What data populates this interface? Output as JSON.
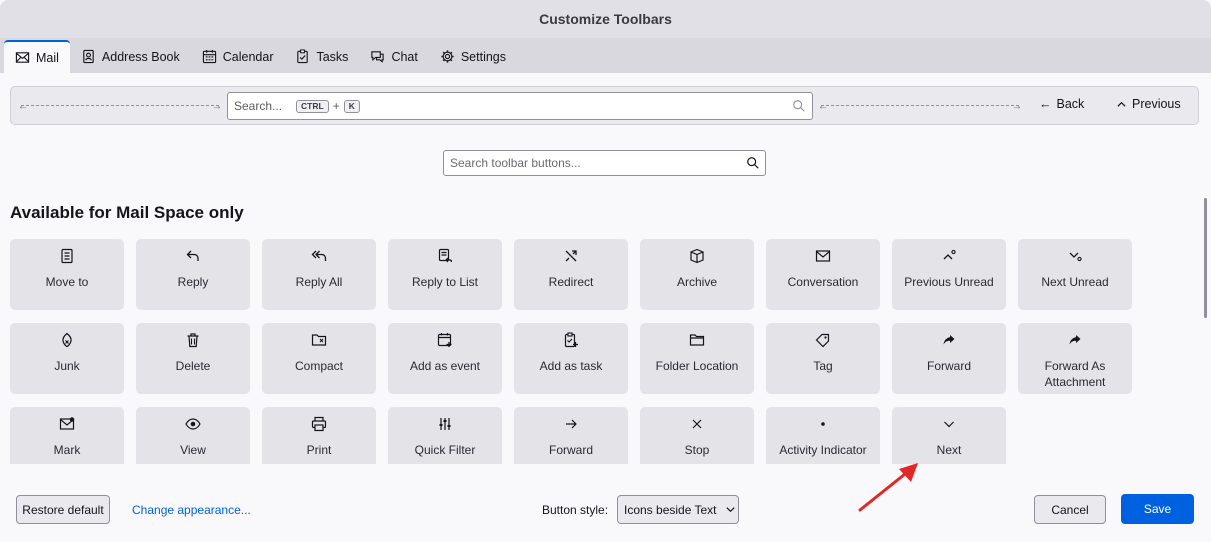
{
  "window": {
    "title": "Customize Toolbars"
  },
  "tabs": [
    {
      "label": "Mail",
      "icon": "mail-icon",
      "active": true
    },
    {
      "label": "Address Book",
      "icon": "address-book-icon"
    },
    {
      "label": "Calendar",
      "icon": "calendar-icon"
    },
    {
      "label": "Tasks",
      "icon": "tasks-icon"
    },
    {
      "label": "Chat",
      "icon": "chat-icon"
    },
    {
      "label": "Settings",
      "icon": "gear-icon"
    }
  ],
  "toolbar": {
    "search_placeholder": "Search...",
    "shortcut_key1": "CTRL",
    "shortcut_plus": "+",
    "shortcut_key2": "K",
    "back_label": "Back",
    "previous_label": "Previous"
  },
  "filter": {
    "placeholder": "Search toolbar buttons..."
  },
  "section": {
    "title": "Available for Mail Space only"
  },
  "buttons": [
    {
      "label": "Move to",
      "icon": "move-to-icon"
    },
    {
      "label": "Reply",
      "icon": "reply-icon"
    },
    {
      "label": "Reply All",
      "icon": "reply-all-icon"
    },
    {
      "label": "Reply to List",
      "icon": "reply-list-icon"
    },
    {
      "label": "Redirect",
      "icon": "redirect-icon"
    },
    {
      "label": "Archive",
      "icon": "archive-icon"
    },
    {
      "label": "Conversation",
      "icon": "conversation-icon"
    },
    {
      "label": "Previous Unread",
      "icon": "previous-unread-icon"
    },
    {
      "label": "Next Unread",
      "icon": "next-unread-icon"
    },
    {
      "label": "Junk",
      "icon": "junk-icon"
    },
    {
      "label": "Delete",
      "icon": "trash-icon"
    },
    {
      "label": "Compact",
      "icon": "compact-icon"
    },
    {
      "label": "Add as event",
      "icon": "add-event-icon"
    },
    {
      "label": "Add as task",
      "icon": "add-task-icon"
    },
    {
      "label": "Folder Location",
      "icon": "folder-icon"
    },
    {
      "label": "Tag",
      "icon": "tag-icon"
    },
    {
      "label": "Forward",
      "icon": "forward-icon"
    },
    {
      "label": "Forward As Attachment",
      "icon": "forward-attachment-icon"
    },
    {
      "label": "Mark",
      "icon": "mark-icon"
    },
    {
      "label": "View",
      "icon": "eye-icon"
    },
    {
      "label": "Print",
      "icon": "print-icon"
    },
    {
      "label": "Quick Filter",
      "icon": "quick-filter-icon"
    },
    {
      "label": "Forward",
      "icon": "arrow-right-icon"
    },
    {
      "label": "Stop",
      "icon": "stop-icon"
    },
    {
      "label": "Activity Indicator",
      "icon": "activity-indicator-icon"
    },
    {
      "label": "Next",
      "icon": "chevron-down-icon"
    }
  ],
  "footer": {
    "restore_label": "Restore default",
    "appearance_link": "Change appearance...",
    "button_style_label": "Button style:",
    "button_style_value": "Icons beside Text",
    "cancel_label": "Cancel",
    "save_label": "Save"
  },
  "colors": {
    "accent": "#0061e0",
    "annotation_arrow": "#e22727"
  }
}
